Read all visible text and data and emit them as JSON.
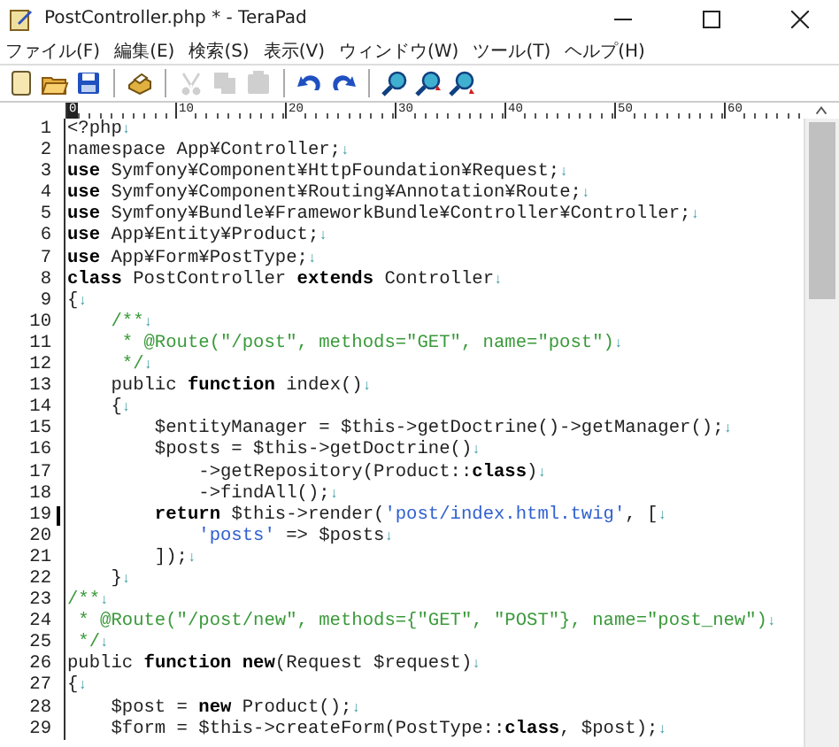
{
  "window": {
    "title": "PostController.php * - TeraPad"
  },
  "menu": [
    "ファイル(F)",
    "編集(E)",
    "検索(S)",
    "表示(V)",
    "ウィンドウ(W)",
    "ツール(T)",
    "ヘルプ(H)"
  ],
  "toolbar": [
    [
      {
        "kind": "new",
        "disabled": false
      },
      {
        "kind": "open",
        "disabled": false
      },
      {
        "kind": "save",
        "disabled": false
      }
    ],
    [
      {
        "kind": "print",
        "disabled": false
      }
    ],
    [
      {
        "kind": "cut",
        "disabled": true
      },
      {
        "kind": "copy",
        "disabled": true
      },
      {
        "kind": "paste",
        "disabled": true
      }
    ],
    [
      {
        "kind": "undo",
        "disabled": false
      },
      {
        "kind": "redo",
        "disabled": false
      }
    ],
    [
      {
        "kind": "find",
        "disabled": false
      },
      {
        "kind": "find-prev",
        "disabled": false
      },
      {
        "kind": "find-next",
        "disabled": false
      }
    ]
  ],
  "ruler": [
    {
      "label": "0",
      "selected": true
    },
    {
      "label": "10",
      "selected": false
    },
    {
      "label": "20",
      "selected": false
    },
    {
      "label": "30",
      "selected": false
    },
    {
      "label": "40",
      "selected": false
    },
    {
      "label": "50",
      "selected": false
    },
    {
      "label": "60",
      "selected": false
    }
  ],
  "lines": [
    {
      "number": "1",
      "cursor": false,
      "eol": "↓",
      "segments": [
        {
          "kind": "plain",
          "text": "<?php"
        }
      ]
    },
    {
      "number": "2",
      "cursor": false,
      "eol": "↓",
      "segments": [
        {
          "kind": "plain",
          "text": "namespace App¥Controller;"
        }
      ]
    },
    {
      "number": "3",
      "cursor": false,
      "eol": "↓",
      "segments": [
        {
          "kind": "keyword",
          "text": "use"
        },
        {
          "kind": "plain",
          "text": " Symfony¥Component¥HttpFoundation¥Request;"
        }
      ]
    },
    {
      "number": "4",
      "cursor": false,
      "eol": "↓",
      "segments": [
        {
          "kind": "keyword",
          "text": "use"
        },
        {
          "kind": "plain",
          "text": " Symfony¥Component¥Routing¥Annotation¥Route;"
        }
      ]
    },
    {
      "number": "5",
      "cursor": false,
      "eol": "↓",
      "segments": [
        {
          "kind": "keyword",
          "text": "use"
        },
        {
          "kind": "plain",
          "text": " Symfony¥Bundle¥FrameworkBundle¥Controller¥Controller;"
        }
      ]
    },
    {
      "number": "6",
      "cursor": false,
      "eol": "↓",
      "segments": [
        {
          "kind": "keyword",
          "text": "use"
        },
        {
          "kind": "plain",
          "text": " App¥Entity¥Product;"
        }
      ]
    },
    {
      "number": "7",
      "cursor": false,
      "eol": "↓",
      "segments": [
        {
          "kind": "keyword",
          "text": "use"
        },
        {
          "kind": "plain",
          "text": " App¥Form¥PostType;"
        }
      ]
    },
    {
      "number": "8",
      "cursor": false,
      "eol": "↓",
      "segments": [
        {
          "kind": "keyword",
          "text": "class"
        },
        {
          "kind": "plain",
          "text": " PostController "
        },
        {
          "kind": "keyword",
          "text": "extends"
        },
        {
          "kind": "plain",
          "text": " Controller"
        }
      ]
    },
    {
      "number": "9",
      "cursor": false,
      "eol": "↓",
      "segments": [
        {
          "kind": "plain",
          "text": "{"
        }
      ]
    },
    {
      "number": "10",
      "cursor": false,
      "eol": "↓",
      "segments": [
        {
          "kind": "comment",
          "text": "    /**"
        }
      ]
    },
    {
      "number": "11",
      "cursor": false,
      "eol": "↓",
      "segments": [
        {
          "kind": "comment",
          "text": "     * @Route(\"/post\", methods=\"GET\", name=\"post\")"
        }
      ]
    },
    {
      "number": "12",
      "cursor": false,
      "eol": "↓",
      "segments": [
        {
          "kind": "comment",
          "text": "     */"
        }
      ]
    },
    {
      "number": "13",
      "cursor": false,
      "eol": "↓",
      "segments": [
        {
          "kind": "plain",
          "text": "    public "
        },
        {
          "kind": "keyword",
          "text": "function"
        },
        {
          "kind": "plain",
          "text": " index()"
        }
      ]
    },
    {
      "number": "14",
      "cursor": false,
      "eol": "↓",
      "segments": [
        {
          "kind": "plain",
          "text": "    {"
        }
      ]
    },
    {
      "number": "15",
      "cursor": false,
      "eol": "↓",
      "segments": [
        {
          "kind": "plain",
          "text": "        $entityManager = $this->getDoctrine()->getManager();"
        }
      ]
    },
    {
      "number": "16",
      "cursor": false,
      "eol": "↓",
      "segments": [
        {
          "kind": "plain",
          "text": "        $posts = $this->getDoctrine()"
        }
      ]
    },
    {
      "number": "17",
      "cursor": false,
      "eol": "↓",
      "segments": [
        {
          "kind": "plain",
          "text": "            ->getRepository(Product::"
        },
        {
          "kind": "keyword",
          "text": "class"
        },
        {
          "kind": "plain",
          "text": ")"
        }
      ]
    },
    {
      "number": "18",
      "cursor": false,
      "eol": "↓",
      "segments": [
        {
          "kind": "plain",
          "text": "            ->findAll();"
        }
      ]
    },
    {
      "number": "19",
      "cursor": true,
      "eol": "↓",
      "segments": [
        {
          "kind": "keyword",
          "text": "        return"
        },
        {
          "kind": "plain",
          "text": " $this->render("
        },
        {
          "kind": "string",
          "text": "'post/index.html.twig'"
        },
        {
          "kind": "plain",
          "text": ", ["
        }
      ]
    },
    {
      "number": "20",
      "cursor": false,
      "eol": "↓",
      "segments": [
        {
          "kind": "string",
          "text": "            'posts'"
        },
        {
          "kind": "plain",
          "text": " => $posts"
        }
      ]
    },
    {
      "number": "21",
      "cursor": false,
      "eol": "↓",
      "segments": [
        {
          "kind": "plain",
          "text": "        ]);"
        }
      ]
    },
    {
      "number": "22",
      "cursor": false,
      "eol": "↓",
      "segments": [
        {
          "kind": "plain",
          "text": "    }"
        }
      ]
    },
    {
      "number": "23",
      "cursor": false,
      "eol": "↓",
      "segments": [
        {
          "kind": "comment",
          "text": "/**"
        }
      ]
    },
    {
      "number": "24",
      "cursor": false,
      "eol": "↓",
      "segments": [
        {
          "kind": "comment",
          "text": " * @Route(\"/post/new\", methods={\"GET\", \"POST\"}, name=\"post_new\")"
        }
      ]
    },
    {
      "number": "25",
      "cursor": false,
      "eol": "↓",
      "segments": [
        {
          "kind": "comment",
          "text": " */"
        }
      ]
    },
    {
      "number": "26",
      "cursor": false,
      "eol": "↓",
      "segments": [
        {
          "kind": "plain",
          "text": "public "
        },
        {
          "kind": "keyword",
          "text": "function new"
        },
        {
          "kind": "plain",
          "text": "(Request $request)"
        }
      ]
    },
    {
      "number": "27",
      "cursor": false,
      "eol": "↓",
      "segments": [
        {
          "kind": "plain",
          "text": "{"
        }
      ]
    },
    {
      "number": "28",
      "cursor": false,
      "eol": "↓",
      "segments": [
        {
          "kind": "plain",
          "text": "    $post = "
        },
        {
          "kind": "keyword",
          "text": "new"
        },
        {
          "kind": "plain",
          "text": " Product();"
        }
      ]
    },
    {
      "number": "29",
      "cursor": false,
      "eol": "↓",
      "segments": [
        {
          "kind": "plain",
          "text": "    $form = $this->createForm(PostType::"
        },
        {
          "kind": "keyword",
          "text": "class"
        },
        {
          "kind": "plain",
          "text": ", $post);"
        }
      ]
    }
  ]
}
